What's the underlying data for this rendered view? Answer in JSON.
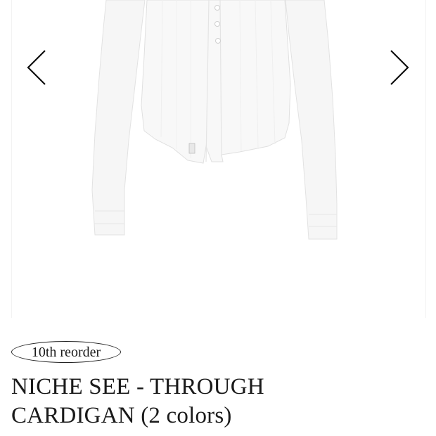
{
  "gallery": {
    "image_alt": "white ribbed see-through cardigan",
    "prev_icon": "chevron-left-icon",
    "next_icon": "chevron-right-icon"
  },
  "product": {
    "badge": "10th reorder",
    "title_line1": "NICHE SEE - THROUGH",
    "title_line2": "CARDIGAN (2 colors)"
  },
  "colors": {
    "background": "#ffffff",
    "garment": "#f7f7f7",
    "text": "#1a1a1a"
  }
}
